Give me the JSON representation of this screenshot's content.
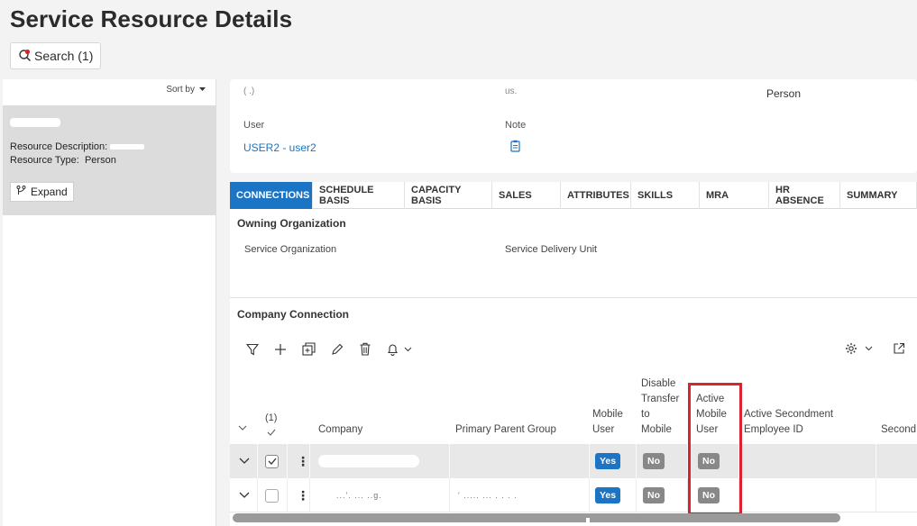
{
  "page": {
    "title": "Service Resource Details"
  },
  "search": {
    "label": "Search (1)"
  },
  "left_panel": {
    "sort_label": "Sort by",
    "card": {
      "resource_description_label": "Resource Description:",
      "resource_type_label": "Resource Type:",
      "resource_type_value": "Person"
    },
    "expand_label": "Expand"
  },
  "details": {
    "person_value": "Person",
    "user_label": "User",
    "user_value": "USER2 - user2",
    "note_label": "Note",
    "partial_1": "( .)",
    "partial_2": "us."
  },
  "tabs": [
    {
      "label": "CONNECTIONS",
      "active": true
    },
    {
      "label": "SCHEDULE BASIS",
      "active": false
    },
    {
      "label": "CAPACITY BASIS",
      "active": false
    },
    {
      "label": "SALES",
      "active": false
    },
    {
      "label": "ATTRIBUTES",
      "active": false
    },
    {
      "label": "SKILLS",
      "active": false
    },
    {
      "label": "MRA",
      "active": false
    },
    {
      "label": "HR ABSENCE",
      "active": false
    },
    {
      "label": "SUMMARY",
      "active": false
    }
  ],
  "owning_org": {
    "title": "Owning Organization",
    "field_1": "Service Organization",
    "field_2": "Service Delivery Unit"
  },
  "company_connection": {
    "title": "Company Connection",
    "columns": {
      "count": "(1)",
      "company": "Company",
      "primary_parent_group": "Primary Parent Group",
      "mobile_user": [
        "Mobile",
        "User"
      ],
      "disable_transfer": [
        "Disable",
        "Transfer",
        "to",
        "Mobile"
      ],
      "active_mobile_user": [
        "Active",
        "Mobile",
        "User"
      ],
      "active_secondment": [
        "Active Secondment",
        "Employee ID"
      ],
      "second": "Second"
    },
    "rows": [
      {
        "mobile_user": "Yes",
        "disable_transfer": "No",
        "active_mobile_user": "No",
        "selected": true,
        "company_text": "",
        "parent_text": ""
      },
      {
        "mobile_user": "Yes",
        "disable_transfer": "No",
        "active_mobile_user": "No",
        "selected": false,
        "company_text": "...'. ... ..g.",
        "parent_text": "' ..... ... . . . ."
      }
    ]
  }
}
